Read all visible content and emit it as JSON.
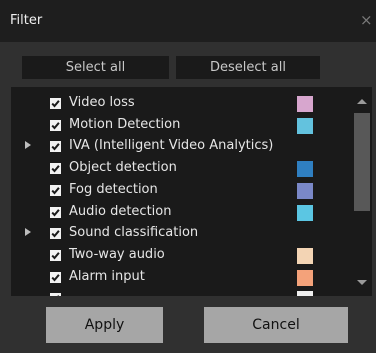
{
  "dialog": {
    "title": "Filter",
    "close_glyph": "×"
  },
  "toolbar": {
    "select_all": "Select all",
    "deselect_all": "Deselect all"
  },
  "items": [
    {
      "label": "Video loss",
      "checked": true,
      "expandable": false,
      "color": "#d7a6ce"
    },
    {
      "label": "Motion Detection",
      "checked": true,
      "expandable": false,
      "color": "#63c2de"
    },
    {
      "label": "IVA (Intelligent Video Analytics)",
      "checked": true,
      "expandable": true,
      "color": ""
    },
    {
      "label": "Object detection",
      "checked": true,
      "expandable": false,
      "color": "#2f7fc1"
    },
    {
      "label": "Fog detection",
      "checked": true,
      "expandable": false,
      "color": "#7a88c8"
    },
    {
      "label": "Audio detection",
      "checked": true,
      "expandable": false,
      "color": "#5bc6e3"
    },
    {
      "label": "Sound classification",
      "checked": true,
      "expandable": true,
      "color": ""
    },
    {
      "label": "Two-way audio",
      "checked": true,
      "expandable": false,
      "color": "#f3d4b4"
    },
    {
      "label": "Alarm input",
      "checked": true,
      "expandable": false,
      "color": "#f4a27a"
    },
    {
      "label": "",
      "checked": true,
      "expandable": false,
      "color": "#f0f0f0"
    }
  ],
  "icons": {
    "expander": "expand-arrow-icon",
    "check": "checkmark-icon",
    "close": "close-icon"
  },
  "footer": {
    "apply": "Apply",
    "cancel": "Cancel"
  }
}
